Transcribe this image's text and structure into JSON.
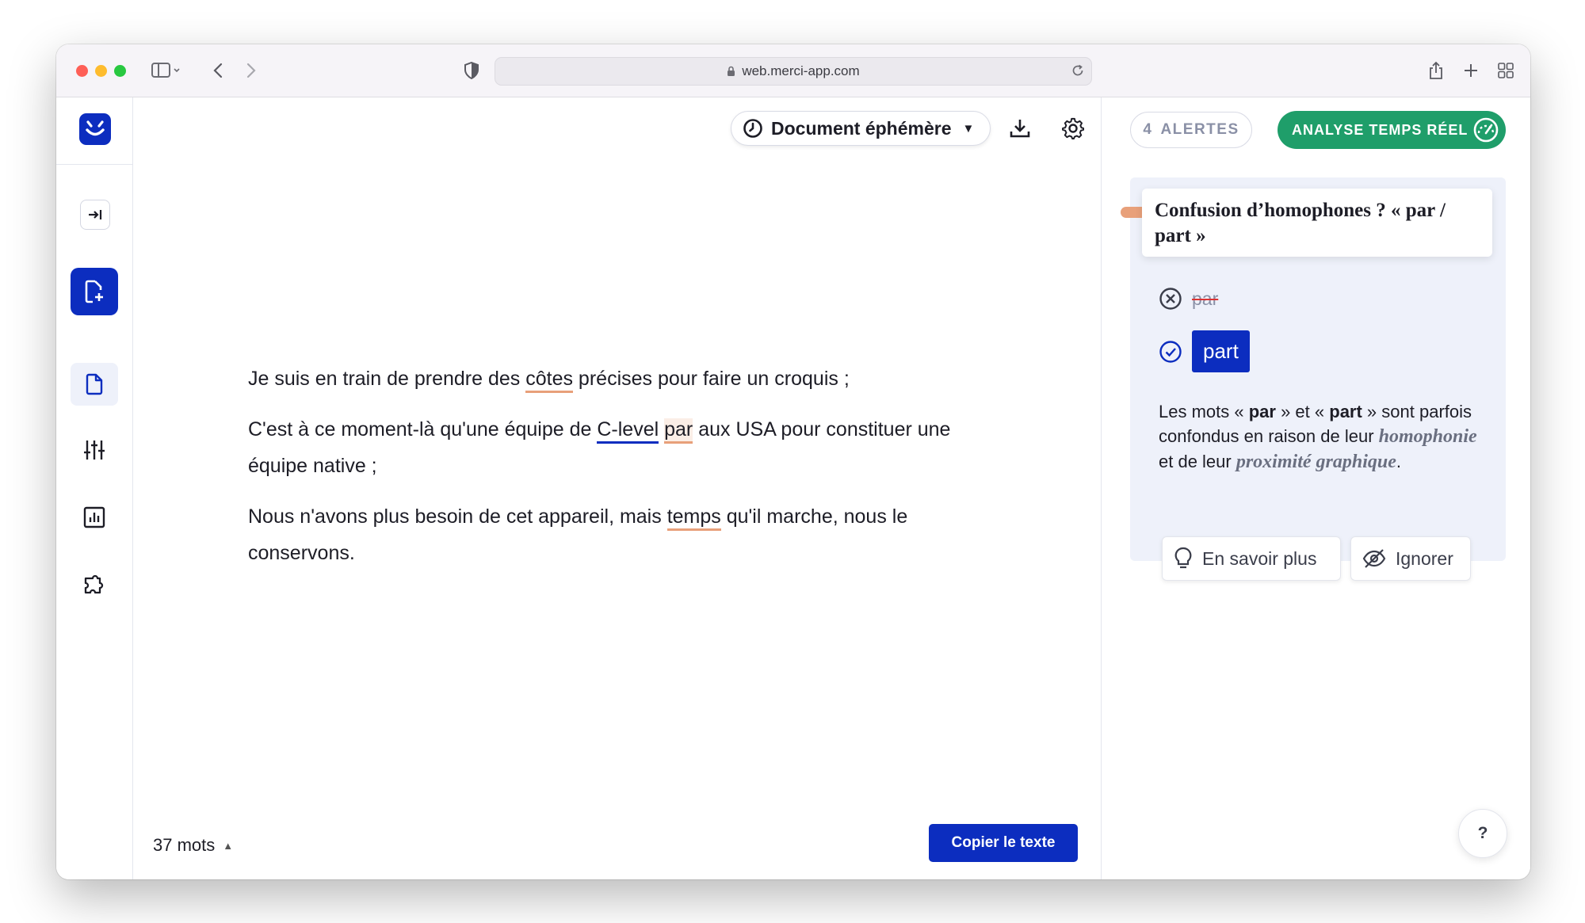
{
  "browser": {
    "url": "web.merci-app.com"
  },
  "editor": {
    "document_mode": "Document éphémère",
    "word_count": "37 mots",
    "copy_button": "Copier le texte",
    "paragraphs": [
      {
        "before": "Je suis en train de prendre des ",
        "flag1": "côtes",
        "after": " précises pour faire un croquis ;"
      },
      {
        "before": "C'est à ce moment-là qu'une équipe de ",
        "flag1": "C-level",
        "mid": " ",
        "flag2": "par",
        "after": " aux USA pour constituer une équipe native ;"
      },
      {
        "before": "Nous n'avons plus besoin de cet appareil, mais ",
        "flag1": "temps",
        "after": " qu'il marche, nous le conservons."
      }
    ]
  },
  "panel": {
    "alerts_count": "4",
    "alerts_label": "ALERTES",
    "realtime_label": "ANALYSE TEMPS RÉEL",
    "card": {
      "title": "Confusion d’homophones ? « par / part »",
      "wrong": "par",
      "right": "part",
      "explain": {
        "t1": "Les mots « ",
        "b1": "par",
        "t2": " » et « ",
        "b2": "part",
        "t3": " » sont parfois confondus en raison de leur ",
        "i1": "homophonie",
        "t4": " et de leur ",
        "i2": "proximité graphique",
        "t5": "."
      },
      "learn_more": "En savoir plus",
      "ignore": "Ignorer"
    },
    "help": "?"
  },
  "colors": {
    "brand_blue": "#0c2dbf",
    "realtime_green": "#1f9e6a",
    "alert_orange": "#e8a07a"
  },
  "icons": [
    "sidebar-icon",
    "chevron-left-icon",
    "chevron-right-icon",
    "shield-icon",
    "lock-icon",
    "reload-icon",
    "share-icon",
    "plus-icon",
    "tabs-grid-icon",
    "smiley-logo-icon",
    "collapse-icon",
    "new-document-icon",
    "document-icon",
    "sliders-icon",
    "chart-icon",
    "puzzle-icon",
    "clock-icon",
    "download-icon",
    "gear-icon",
    "gauge-icon",
    "x-circle-icon",
    "check-circle-icon",
    "lightbulb-icon",
    "eye-off-icon"
  ]
}
